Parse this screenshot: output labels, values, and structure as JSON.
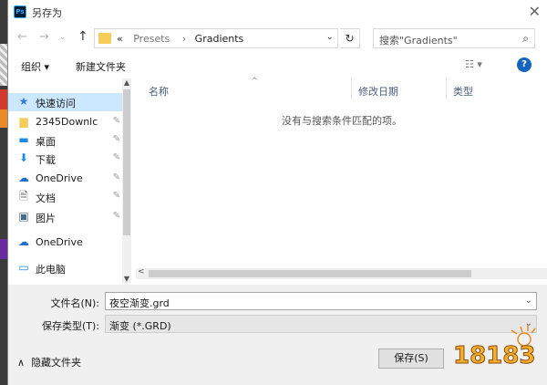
{
  "window": {
    "title": "另存为",
    "app_icon_text": "Ps"
  },
  "address": {
    "crumbs": [
      "«",
      "Presets",
      "›",
      "Gradients"
    ],
    "search_placeholder": "搜索\"Gradients\""
  },
  "toolbar": {
    "organize_label": "组织 ▾",
    "new_folder_label": "新建文件夹"
  },
  "nav": {
    "items": [
      {
        "label": "快速访问",
        "icon": "star-icon",
        "selected": true,
        "pinned": false
      },
      {
        "label": "2345Downlc",
        "icon": "folder-icon",
        "selected": false,
        "pinned": true
      },
      {
        "label": "桌面",
        "icon": "desktop-icon",
        "selected": false,
        "pinned": true
      },
      {
        "label": "下载",
        "icon": "download-icon",
        "selected": false,
        "pinned": true
      },
      {
        "label": "OneDrive",
        "icon": "cloud-icon",
        "selected": false,
        "pinned": true
      },
      {
        "label": "文档",
        "icon": "document-icon",
        "selected": false,
        "pinned": true
      },
      {
        "label": "图片",
        "icon": "pictures-icon",
        "selected": false,
        "pinned": true
      },
      {
        "label": "OneDrive",
        "icon": "cloud-icon",
        "selected": false,
        "pinned": false
      },
      {
        "label": "此电脑",
        "icon": "computer-icon",
        "selected": false,
        "pinned": false
      }
    ]
  },
  "filelist": {
    "columns": [
      "名称",
      "修改日期",
      "类型"
    ],
    "empty_message": "没有与搜索条件匹配的项。"
  },
  "form": {
    "filename_label": "文件名(N):",
    "filename_value": "夜空渐变.grd",
    "filetype_label": "保存类型(T):",
    "filetype_value": "渐变 (*.GRD)"
  },
  "footer": {
    "hide_folders_label": "隐藏文件夹",
    "save_label": "保存(S)",
    "cancel_label": "取消"
  },
  "watermark": {
    "text": "18183"
  },
  "colors": {
    "accent": "#1565c0",
    "selection": "#cce8ff",
    "folder": "#f5cd5b"
  }
}
